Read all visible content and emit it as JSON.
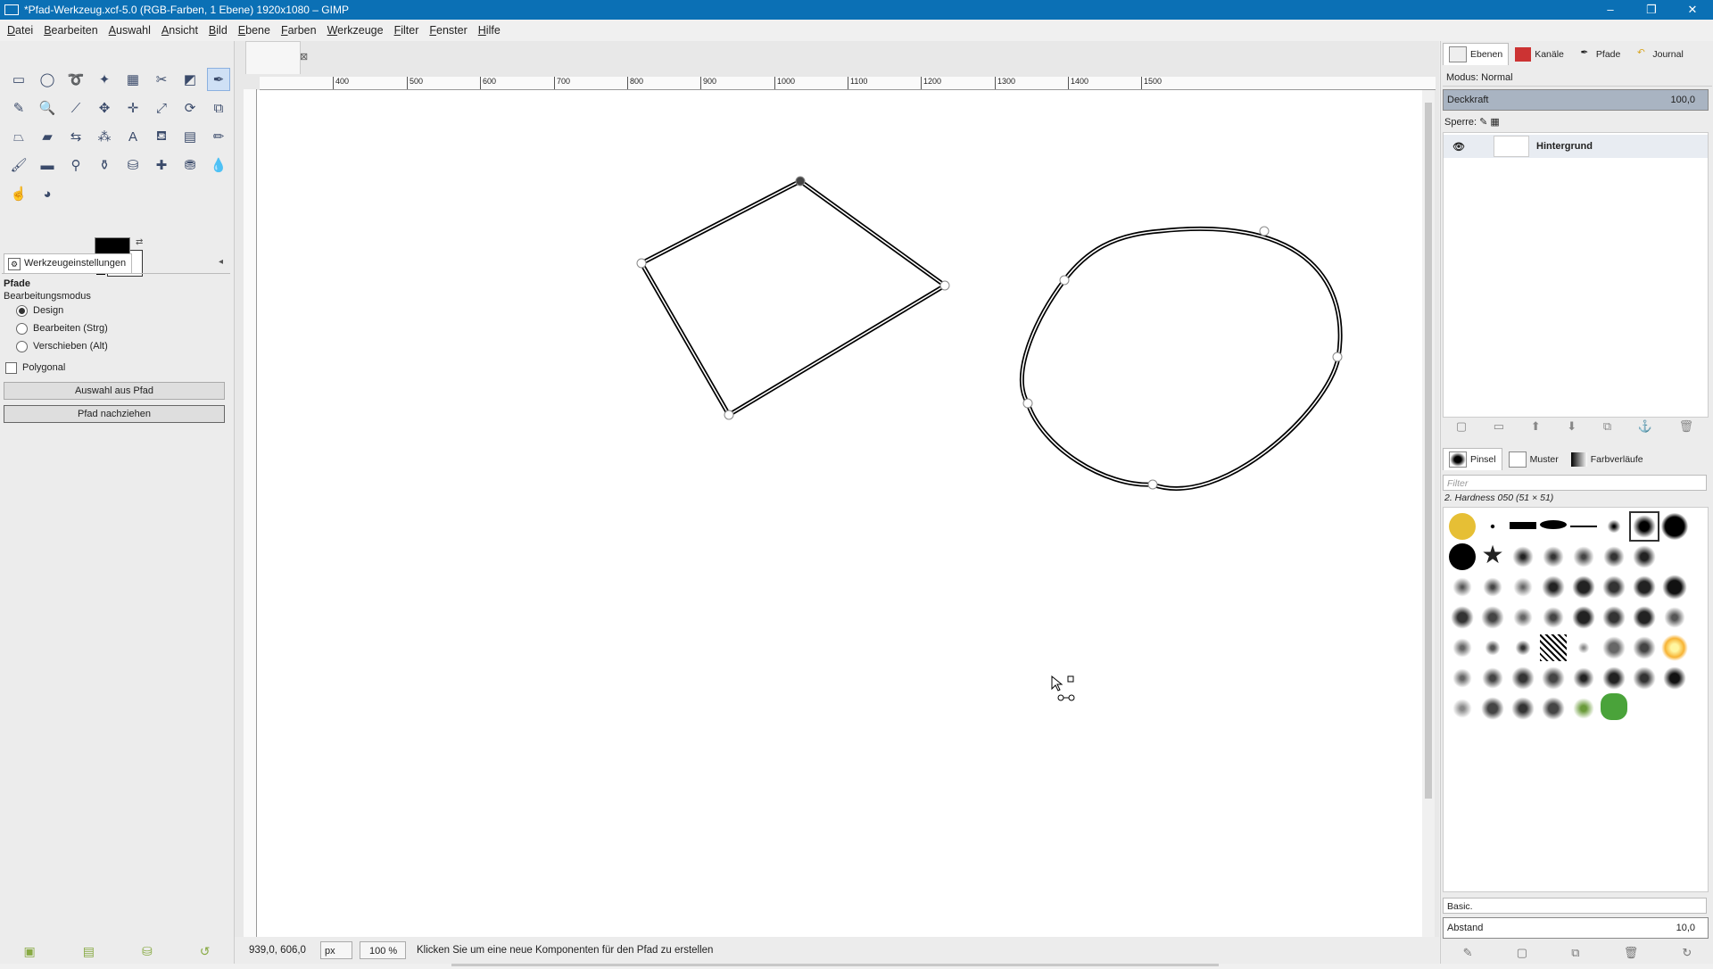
{
  "window": {
    "title": "*Pfad-Werkzeug.xcf-5.0 (RGB-Farben, 1 Ebene) 1920x1080 – GIMP",
    "buttons": [
      "–",
      "❐",
      "✕"
    ]
  },
  "menu": [
    "Datei",
    "Bearbeiten",
    "Auswahl",
    "Ansicht",
    "Bild",
    "Ebene",
    "Farben",
    "Werkzeuge",
    "Filter",
    "Fenster",
    "Hilfe"
  ],
  "tool_options": {
    "tab_label": "Werkzeugeinstellungen",
    "title": "Pfade",
    "mode_label": "Bearbeitungsmodus",
    "modes": [
      "Design",
      "Bearbeiten (Strg)",
      "Verschieben (Alt)"
    ],
    "selected_mode": "Design",
    "polygonal_label": "Polygonal",
    "btn_selection": "Auswahl aus Pfad",
    "btn_stroke": "Pfad nachziehen"
  },
  "ruler": {
    "h_labels": [
      "400",
      "500",
      "600",
      "700",
      "800",
      "900",
      "1000",
      "1100",
      "1200",
      "1300",
      "1400",
      "1500"
    ]
  },
  "status": {
    "coords": "939,0, 606,0",
    "unit": "px",
    "zoom": "100 %",
    "hint": "Klicken Sie um eine neue Komponenten für den Pfad zu erstellen"
  },
  "layers_dock": {
    "tabs": [
      "Ebenen",
      "Kanäle",
      "Pfade",
      "Journal"
    ],
    "mode": "Modus: Normal",
    "opacity_label": "Deckkraft",
    "opacity_value": "100,0",
    "lock_label": "Sperre:",
    "layer_name": "Hintergrund"
  },
  "brushes_dock": {
    "tabs": [
      "Pinsel",
      "Muster",
      "Farbverläufe"
    ],
    "filter_placeholder": "Filter",
    "brush_name": "2. Hardness 050 (51 × 51)",
    "preset": "Basic.",
    "spacing_label": "Abstand",
    "spacing_value": "10,0"
  },
  "colors": {
    "accent": "#0b70b5",
    "foreground": "#000000",
    "background": "#ffffff"
  }
}
